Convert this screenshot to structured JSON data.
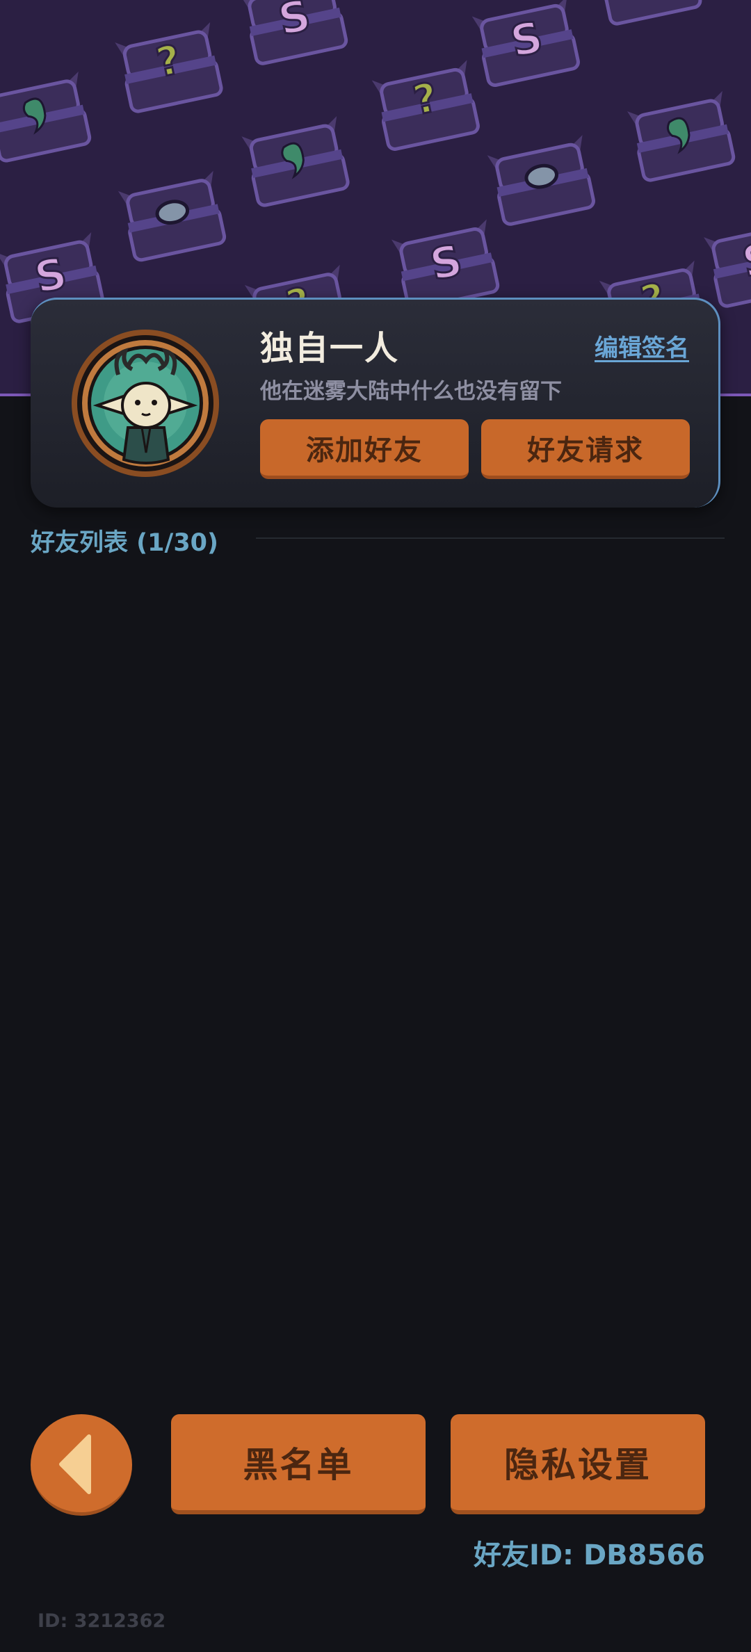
{
  "profile": {
    "nickname": "独自一人",
    "edit_signature_label": "编辑签名",
    "signature": "他在迷雾大陆中什么也没有留下",
    "add_friend_label": "添加好友",
    "friend_requests_label": "好友请求"
  },
  "friends_list": {
    "title": "好友列表 (1/30)"
  },
  "bottom": {
    "blacklist_label": "黑名单",
    "privacy_label": "隐私设置",
    "friend_id": "好友ID: DB8566",
    "user_id": "ID: 3212362"
  },
  "icons": {
    "back": "back-arrow-icon",
    "avatar": "cat-avatar-icon"
  },
  "colors": {
    "background": "#121318",
    "banner": "#2b1f43",
    "accent_orange": "#cf6c2c",
    "accent_blue": "#6aa6c4",
    "card": "#23252f"
  }
}
